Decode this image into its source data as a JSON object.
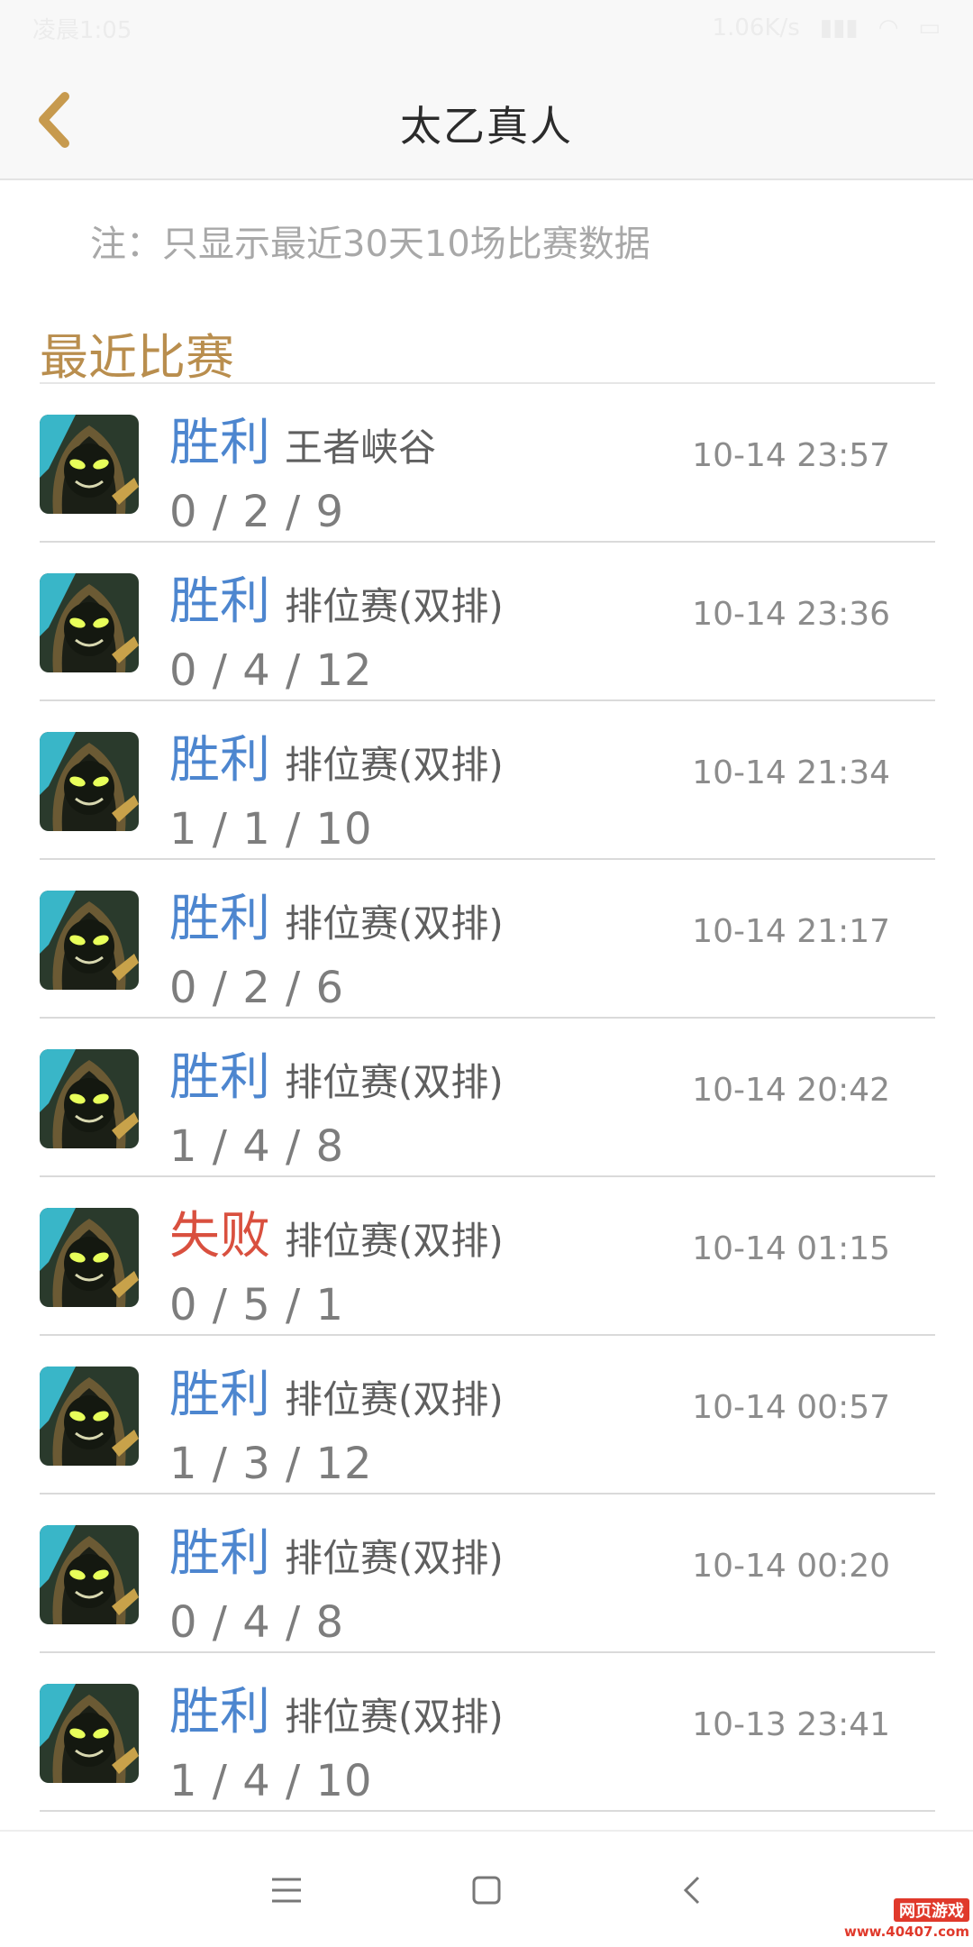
{
  "status_bar": {
    "carrier_time": "凌晨1:05",
    "net_speed": "1.06K/s"
  },
  "header": {
    "title": "太乙真人"
  },
  "note": "注：只显示最近30天10场比赛数据",
  "section_title": "最近比赛",
  "colors": {
    "accent": "#b98e4e",
    "win": "#4d86cf",
    "loss": "#d9503f"
  },
  "matches": [
    {
      "result": "胜利",
      "outcome": "win",
      "mode": "王者峡谷",
      "kda": "0 / 2 / 9",
      "time": "10-14 23:57"
    },
    {
      "result": "胜利",
      "outcome": "win",
      "mode": "排位赛(双排)",
      "kda": "0 / 4 / 12",
      "time": "10-14 23:36"
    },
    {
      "result": "胜利",
      "outcome": "win",
      "mode": "排位赛(双排)",
      "kda": "1 / 1 / 10",
      "time": "10-14 21:34"
    },
    {
      "result": "胜利",
      "outcome": "win",
      "mode": "排位赛(双排)",
      "kda": "0 / 2 / 6",
      "time": "10-14 21:17"
    },
    {
      "result": "胜利",
      "outcome": "win",
      "mode": "排位赛(双排)",
      "kda": "1 / 4 / 8",
      "time": "10-14 20:42"
    },
    {
      "result": "失败",
      "outcome": "loss",
      "mode": "排位赛(双排)",
      "kda": "0 / 5 / 1",
      "time": "10-14 01:15"
    },
    {
      "result": "胜利",
      "outcome": "win",
      "mode": "排位赛(双排)",
      "kda": "1 / 3 / 12",
      "time": "10-14 00:57"
    },
    {
      "result": "胜利",
      "outcome": "win",
      "mode": "排位赛(双排)",
      "kda": "0 / 4 / 8",
      "time": "10-14 00:20"
    },
    {
      "result": "胜利",
      "outcome": "win",
      "mode": "排位赛(双排)",
      "kda": "1 / 4 / 10",
      "time": "10-13 23:41"
    }
  ],
  "navbar": {
    "icons": [
      "menu-icon",
      "home-square-icon",
      "back-chevron-icon"
    ]
  },
  "watermark": {
    "line1": "网页游戏",
    "line2": "www.40407.com"
  }
}
